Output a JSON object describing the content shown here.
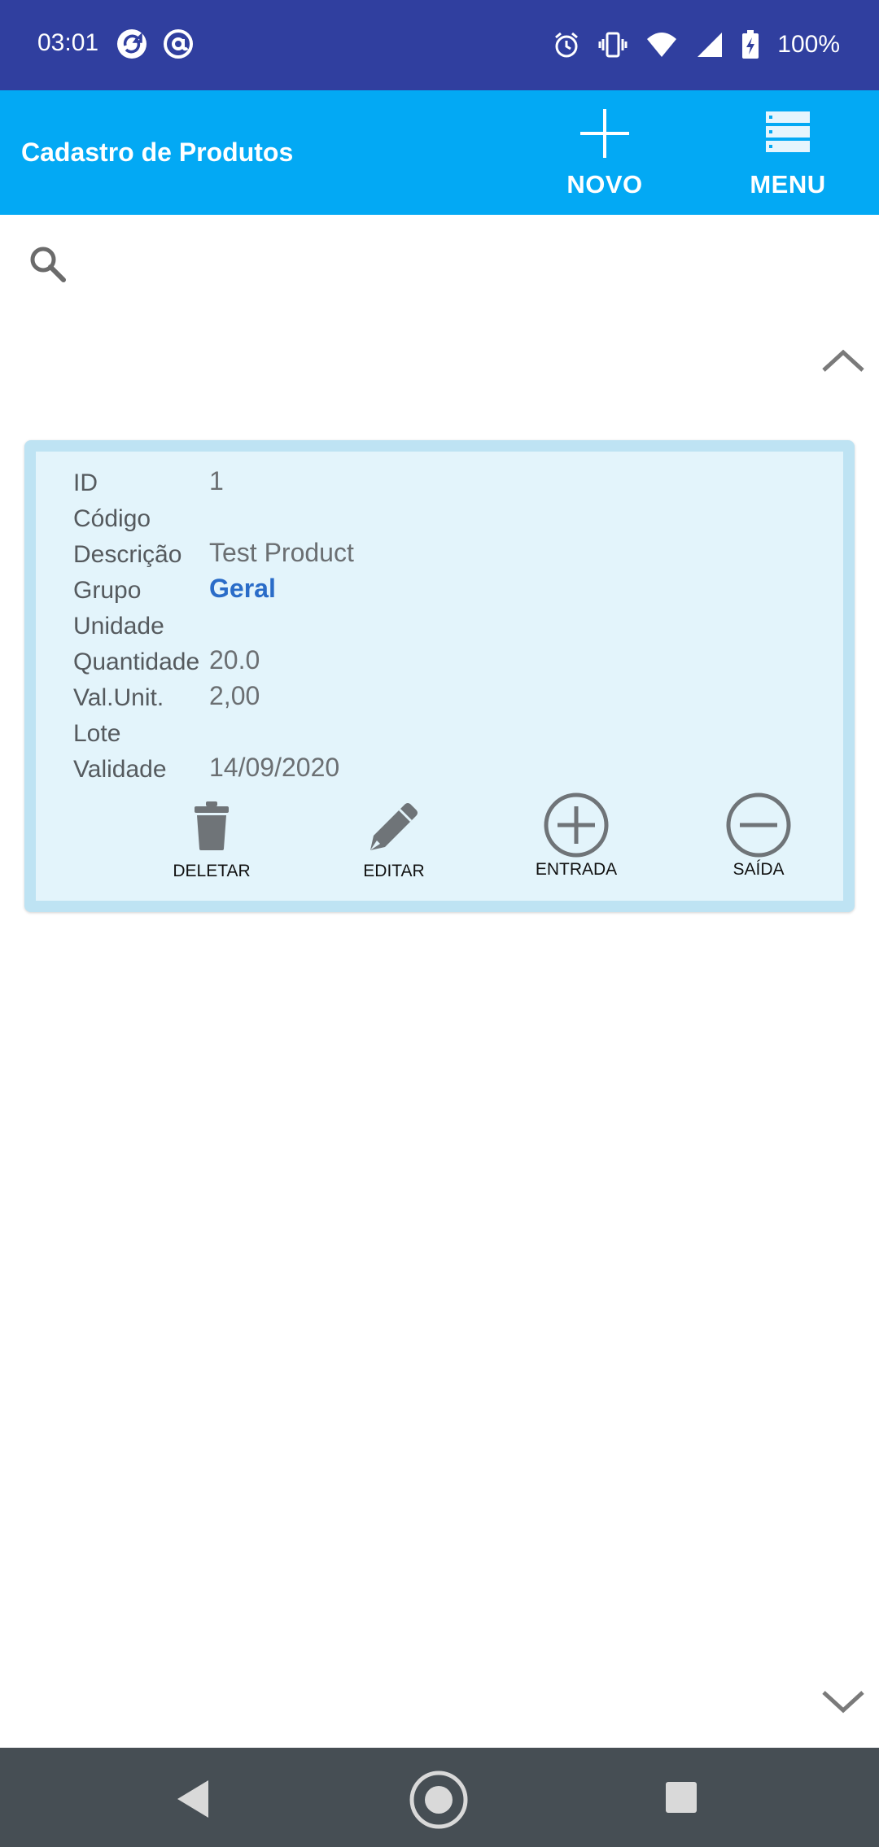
{
  "status_bar": {
    "time": "03:01",
    "battery": "100%",
    "icons": [
      "sync-app-icon",
      "at-app-icon",
      "alarm-icon",
      "vibrate-icon",
      "wifi-icon",
      "signal-icon",
      "battery-charging-icon"
    ]
  },
  "app_bar": {
    "title": "Cadastro de Produtos",
    "new_label": "NOVO",
    "menu_label": "MENU",
    "background": "#03A9F4"
  },
  "search": {
    "placeholder": "",
    "value": ""
  },
  "product": {
    "labels": {
      "id": "ID",
      "code": "Código",
      "description": "Descrição",
      "group": "Grupo",
      "unit": "Unidade",
      "quantity": "Quantidade",
      "unit_price": "Val.Unit.",
      "lot": "Lote",
      "validity": "Validade"
    },
    "values": {
      "id": "1",
      "code": "",
      "description": "Test Product",
      "group": "Geral",
      "unit": "",
      "quantity": "20.0",
      "unit_price": "2,00",
      "lot": "",
      "validity": "14/09/2020"
    },
    "actions": {
      "delete": "DELETAR",
      "edit": "EDITAR",
      "entry": "ENTRADA",
      "exit": "SAÍDA"
    }
  },
  "colors": {
    "status_bar": "#303F9F",
    "app_bar": "#03A9F4",
    "card_border": "#BEE3F3",
    "card_fill": "#E3F4FB",
    "group_value": "#2A6CC8",
    "nav_bar": "#464E54"
  }
}
